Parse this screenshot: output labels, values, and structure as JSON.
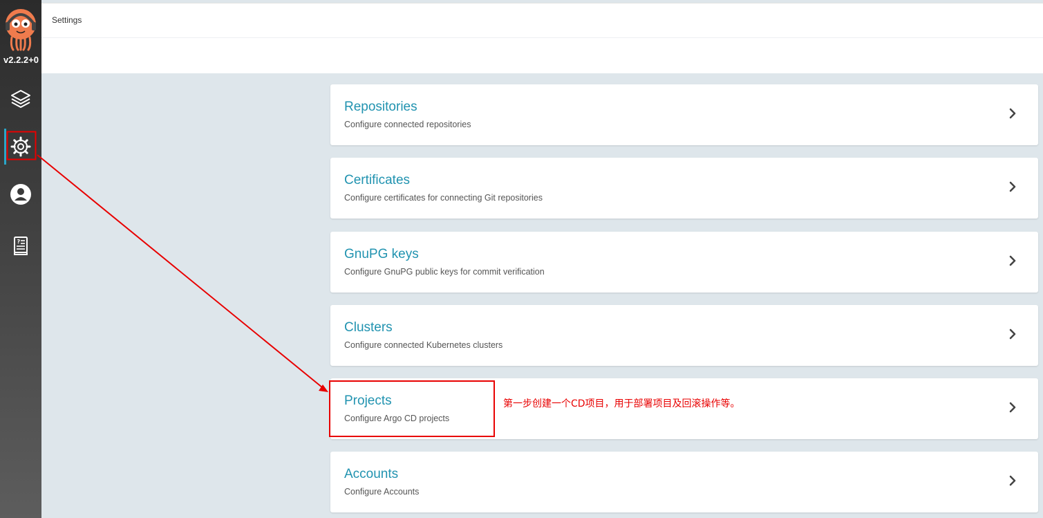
{
  "sidebar": {
    "version": "v2.2.2+0",
    "items": [
      {
        "name": "applications",
        "icon": "layers-icon"
      },
      {
        "name": "settings",
        "icon": "gear-icon",
        "active": true
      },
      {
        "name": "user-info",
        "icon": "user-circle-icon"
      },
      {
        "name": "documentation",
        "icon": "book-icon"
      }
    ]
  },
  "header": {
    "title": "Settings"
  },
  "settings": {
    "cards": [
      {
        "title": "Repositories",
        "desc": "Configure connected repositories"
      },
      {
        "title": "Certificates",
        "desc": "Configure certificates for connecting Git repositories"
      },
      {
        "title": "GnuPG keys",
        "desc": "Configure GnuPG public keys for commit verification"
      },
      {
        "title": "Clusters",
        "desc": "Configure connected Kubernetes clusters"
      },
      {
        "title": "Projects",
        "desc": "Configure Argo CD projects"
      },
      {
        "title": "Accounts",
        "desc": "Configure Accounts"
      }
    ]
  },
  "annotation": {
    "note": "第一步创建一个CD项目，用于部署项目及回滚操作等。",
    "color": "#e80000"
  },
  "colors": {
    "accent": "#2193b0",
    "active_indicator": "#2aa6c8",
    "content_bg": "#dee6eb"
  }
}
